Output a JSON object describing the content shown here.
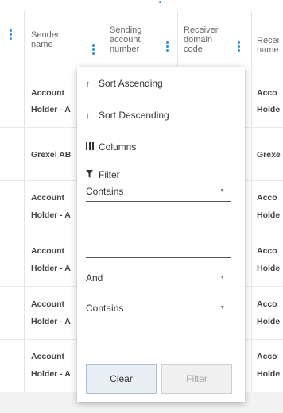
{
  "columns": [
    {
      "label": "Sender name",
      "lines": [
        "Sender",
        "name"
      ]
    },
    {
      "label": "Sending account number",
      "lines": [
        "Sending",
        "account",
        "number"
      ]
    },
    {
      "label": "Receiver domain code",
      "lines": [
        "Receiver",
        "domain",
        "code"
      ]
    },
    {
      "label": "Receiver name",
      "lines": [
        "Recei",
        "name"
      ]
    }
  ],
  "rows": [
    {
      "sender": [
        "Account",
        "Holder - A"
      ],
      "receiver": [
        "Acco",
        "Holde"
      ]
    },
    {
      "sender": [
        "Grexel AB"
      ],
      "receiver": [
        "Grexe"
      ]
    },
    {
      "sender": [
        "Account",
        "Holder - A"
      ],
      "receiver": [
        "Acco",
        "Holde"
      ]
    },
    {
      "sender": [
        "Account",
        "Holder - A"
      ],
      "receiver": [
        "Acco",
        "Holde"
      ]
    },
    {
      "sender": [
        "Account",
        "Holder - A"
      ],
      "receiver": [
        "Acco",
        "Holde"
      ]
    },
    {
      "sender": [
        "Account",
        "Holder - A"
      ],
      "receiver": [
        "Acco",
        "Holde"
      ]
    }
  ],
  "menu": {
    "sort_asc": {
      "icon": "arrow-up-icon",
      "label": "Sort Ascending"
    },
    "sort_desc": {
      "icon": "arrow-down-icon",
      "label": "Sort Descending"
    },
    "columns": {
      "icon": "columns-icon",
      "label": "Columns"
    },
    "filter": {
      "icon": "filter-icon",
      "label": "Filter"
    },
    "operator_1": "Contains",
    "value_1": "",
    "logic": "And",
    "operator_2": "Contains",
    "value_2": "",
    "clear_label": "Clear",
    "apply_label": "Filter"
  },
  "colors": {
    "accent": "#2a8fd6",
    "clear_bg": "#e8eef4",
    "disabled_text": "#aaaaaa"
  }
}
